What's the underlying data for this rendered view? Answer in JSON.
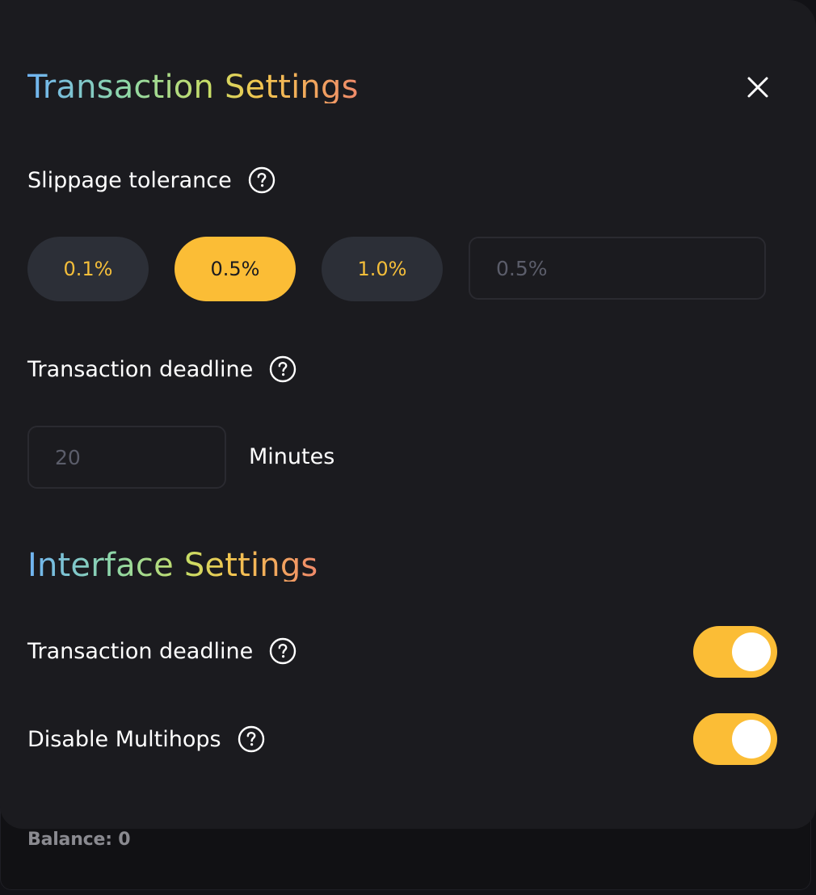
{
  "transaction_settings": {
    "title_part1": "Transaction",
    "title_part2": "Settings",
    "slippage": {
      "label": "Slippage tolerance",
      "options": [
        "0.1%",
        "0.5%",
        "1.0%"
      ],
      "selected": "0.5%",
      "custom_placeholder": "0.5%"
    },
    "deadline": {
      "label": "Transaction deadline",
      "placeholder": "20",
      "unit": "Minutes"
    }
  },
  "interface_settings": {
    "title_part1": "Interface",
    "title_part2": "Settings",
    "rows": [
      {
        "label": "Transaction deadline",
        "on": true
      },
      {
        "label": "Disable Multihops",
        "on": true
      }
    ]
  },
  "footer": {
    "balance": "Balance: 0"
  },
  "colors": {
    "accent": "#fbbd36",
    "panel": "#1b1b1f",
    "pill_inactive": "#2c2f37"
  },
  "icons": {
    "close": "close-icon",
    "help": "question-circle-icon"
  }
}
